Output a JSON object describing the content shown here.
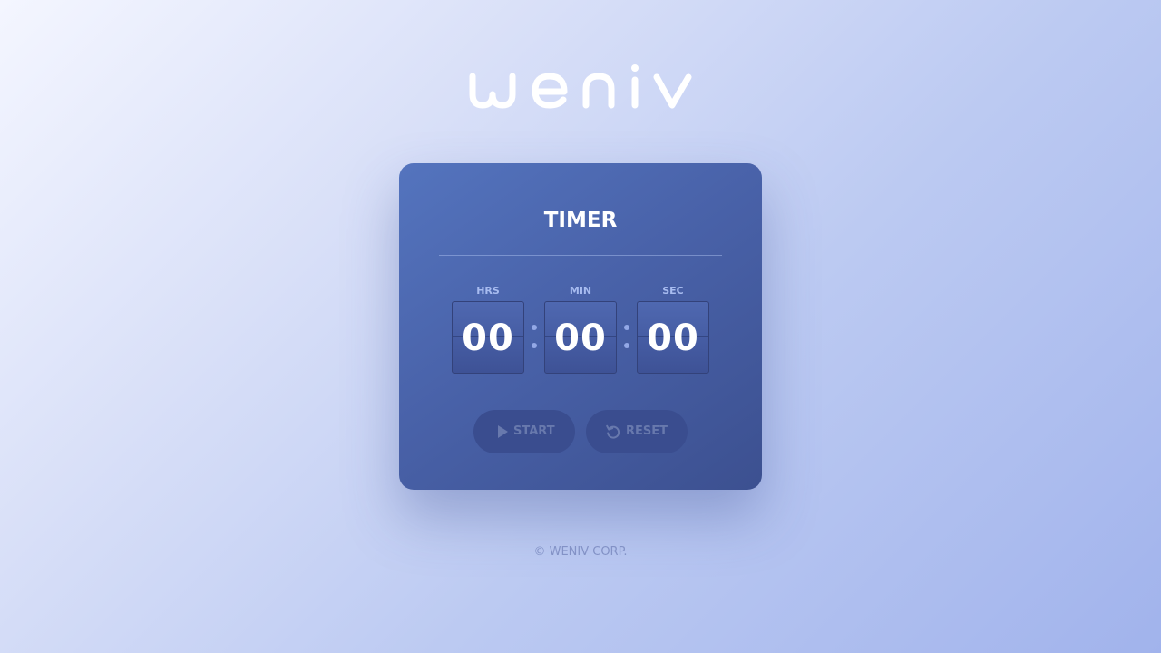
{
  "brand": {
    "logo_text": "weniv",
    "logo_icon": "weniv-logo-icon"
  },
  "timer": {
    "title": "TIMER",
    "units": [
      {
        "label": "HRS",
        "value": "00"
      },
      {
        "label": "MIN",
        "value": "00"
      },
      {
        "label": "SEC",
        "value": "00"
      }
    ],
    "separator_icon": "colon-dots-icon"
  },
  "buttons": {
    "start": {
      "label": "START",
      "icon": "play-icon",
      "enabled": false
    },
    "reset": {
      "label": "RESET",
      "icon": "reset-icon",
      "enabled": false
    }
  },
  "footer": {
    "text": "© WENIV CORP."
  },
  "colors": {
    "background_start": "#f4f6ff",
    "background_end": "#a1b3ec",
    "card": "#4962a9",
    "digit_text": "#ffffff",
    "unit_label": "#a8bcf0",
    "button_bg": "#3a4d8f",
    "button_text": "#6879ad",
    "footer_text": "#8392c6"
  }
}
